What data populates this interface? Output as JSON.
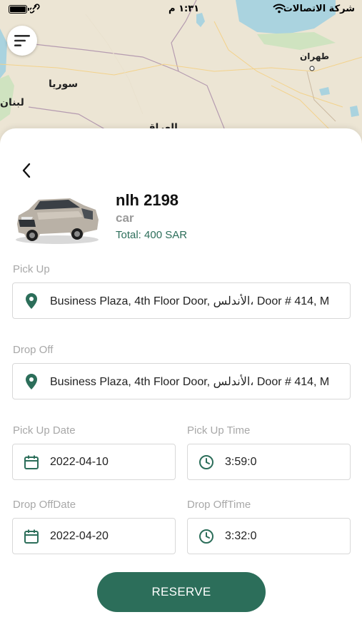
{
  "status_bar": {
    "time": "١:٣١ م",
    "carrier": "شركة الاتصالات"
  },
  "map": {
    "labels": {
      "tehran": "طهران",
      "syria": "سوريا",
      "lebanon": "لبنان",
      "iraq_partial": "العراق"
    }
  },
  "car": {
    "title": "nlh 2198",
    "type": "car",
    "total": "Total: 400 SAR"
  },
  "pickup": {
    "label": "Pick Up",
    "value": "Business Plaza, 4th Floor Door, الأندلس، Door # 414, M"
  },
  "dropoff": {
    "label": "Drop Off",
    "value": "Business Plaza, 4th Floor Door, الأندلس، Door # 414, M"
  },
  "pickup_date": {
    "label": "Pick Up Date",
    "value": "2022-04-10"
  },
  "pickup_time": {
    "label": "Pick Up Time",
    "value": "3:59:0"
  },
  "dropoff_date": {
    "label": "Drop OffDate",
    "value": "2022-04-20"
  },
  "dropoff_time": {
    "label": "Drop OffTime",
    "value": "3:32:0"
  },
  "reserve": {
    "label": "RESERVE"
  },
  "colors": {
    "primary": "#2c6e5a",
    "label_gray": "#a8a8a8",
    "map_land": "#ece5d4",
    "map_water": "#aad3df"
  },
  "icons": {
    "menu": "menu-icon",
    "back": "chevron-left-icon",
    "location": "map-pin-icon",
    "calendar": "calendar-icon",
    "clock": "clock-icon"
  }
}
